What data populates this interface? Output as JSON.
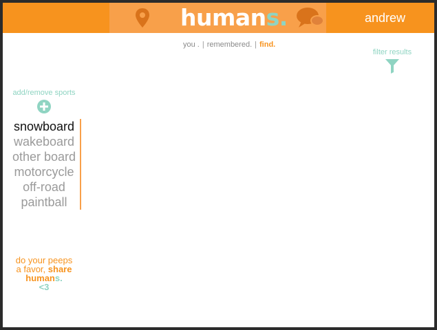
{
  "header": {
    "logo_main": "human",
    "logo_accent": "s.",
    "username": "andrew",
    "location_icon": "location-pin-icon",
    "chat_icon": "chat-bubbles-icon"
  },
  "subnav": {
    "items": [
      "you .",
      "remembered.",
      "find."
    ],
    "separator": "|"
  },
  "filter": {
    "label": "filter results",
    "icon": "funnel-icon"
  },
  "sports_panel": {
    "add_remove_label": "add/remove sports",
    "add_icon": "plus-circle-icon",
    "items": [
      "snowboard",
      "wakeboard",
      "other board",
      "motorcycle",
      "off-road",
      "paintball"
    ],
    "active_item": "snowboard"
  },
  "share": {
    "line1": "do your peeps",
    "line2_prefix": "a favor,",
    "line2_bold": "share",
    "brand_main": "human",
    "brand_accent": "s.",
    "heart": "<3"
  },
  "colors": {
    "orange": "#f7931e",
    "orange_light": "#f8a04a",
    "teal": "#8fd4c2",
    "gray_text": "#9a9a9a"
  }
}
